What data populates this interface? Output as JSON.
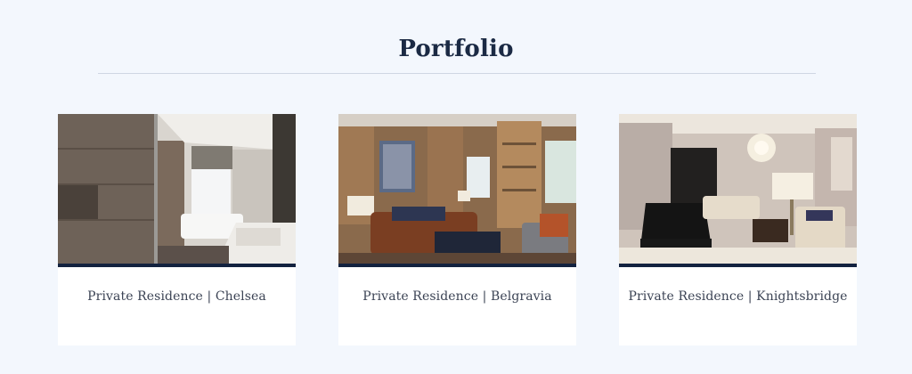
{
  "section": {
    "title": "Portfolio"
  },
  "projects": [
    {
      "caption": "Private Residence | Chelsea",
      "image": "bathroom-interior-photo"
    },
    {
      "caption": "Private Residence | Belgravia",
      "image": "living-room-interior-photo"
    },
    {
      "caption": "Private Residence | Knightsbridge",
      "image": "drawing-room-interior-photo"
    }
  ],
  "colors": {
    "background": "#f3f7fd",
    "accent_navy": "#13223f",
    "title": "#1b2a44",
    "caption": "#3b4354"
  }
}
